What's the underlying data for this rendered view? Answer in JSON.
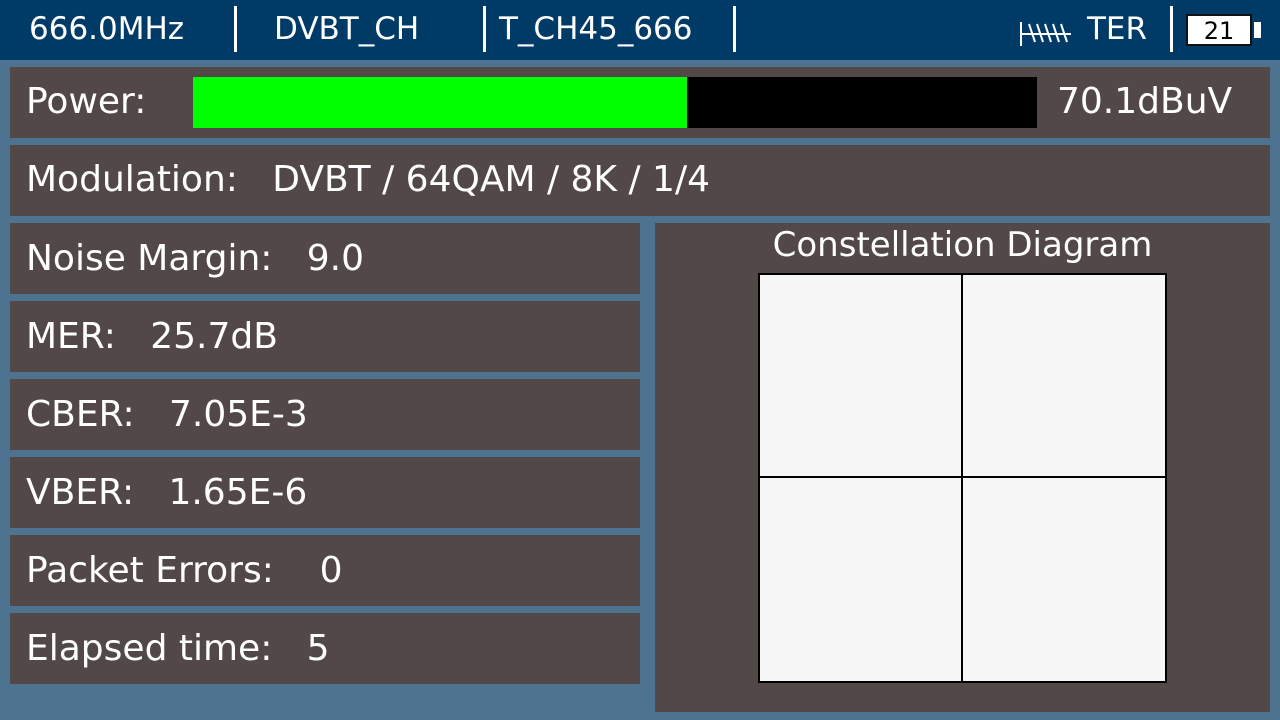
{
  "header": {
    "frequency": "666.0MHz",
    "standard": "DVBT_CH",
    "channel": "T_CH45_666",
    "band": "TER",
    "battery": "21"
  },
  "power": {
    "label": "Power:",
    "value": "70.1dBuV",
    "level_fraction": 0.585,
    "fill_color": "#00ff00"
  },
  "modulation": {
    "label": "Modulation:",
    "value": "DVBT / 64QAM / 8K / 1/4"
  },
  "measurements": [
    {
      "label": "Noise Margin:",
      "value": "9.0"
    },
    {
      "label": "MER:",
      "value": "25.7dB"
    },
    {
      "label": "CBER:",
      "value": "7.05E-3"
    },
    {
      "label": "VBER:",
      "value": "1.65E-6"
    },
    {
      "label": "Packet Errors:",
      "value": "0"
    },
    {
      "label": "Elapsed time:",
      "value": "5"
    }
  ],
  "constellation": {
    "title": "Constellation Diagram"
  },
  "icons": {
    "antenna": "antenna-icon",
    "battery": "battery-icon"
  },
  "colors": {
    "header_bg": "#003a66",
    "background": "#4e7390",
    "panel": "#524848"
  }
}
